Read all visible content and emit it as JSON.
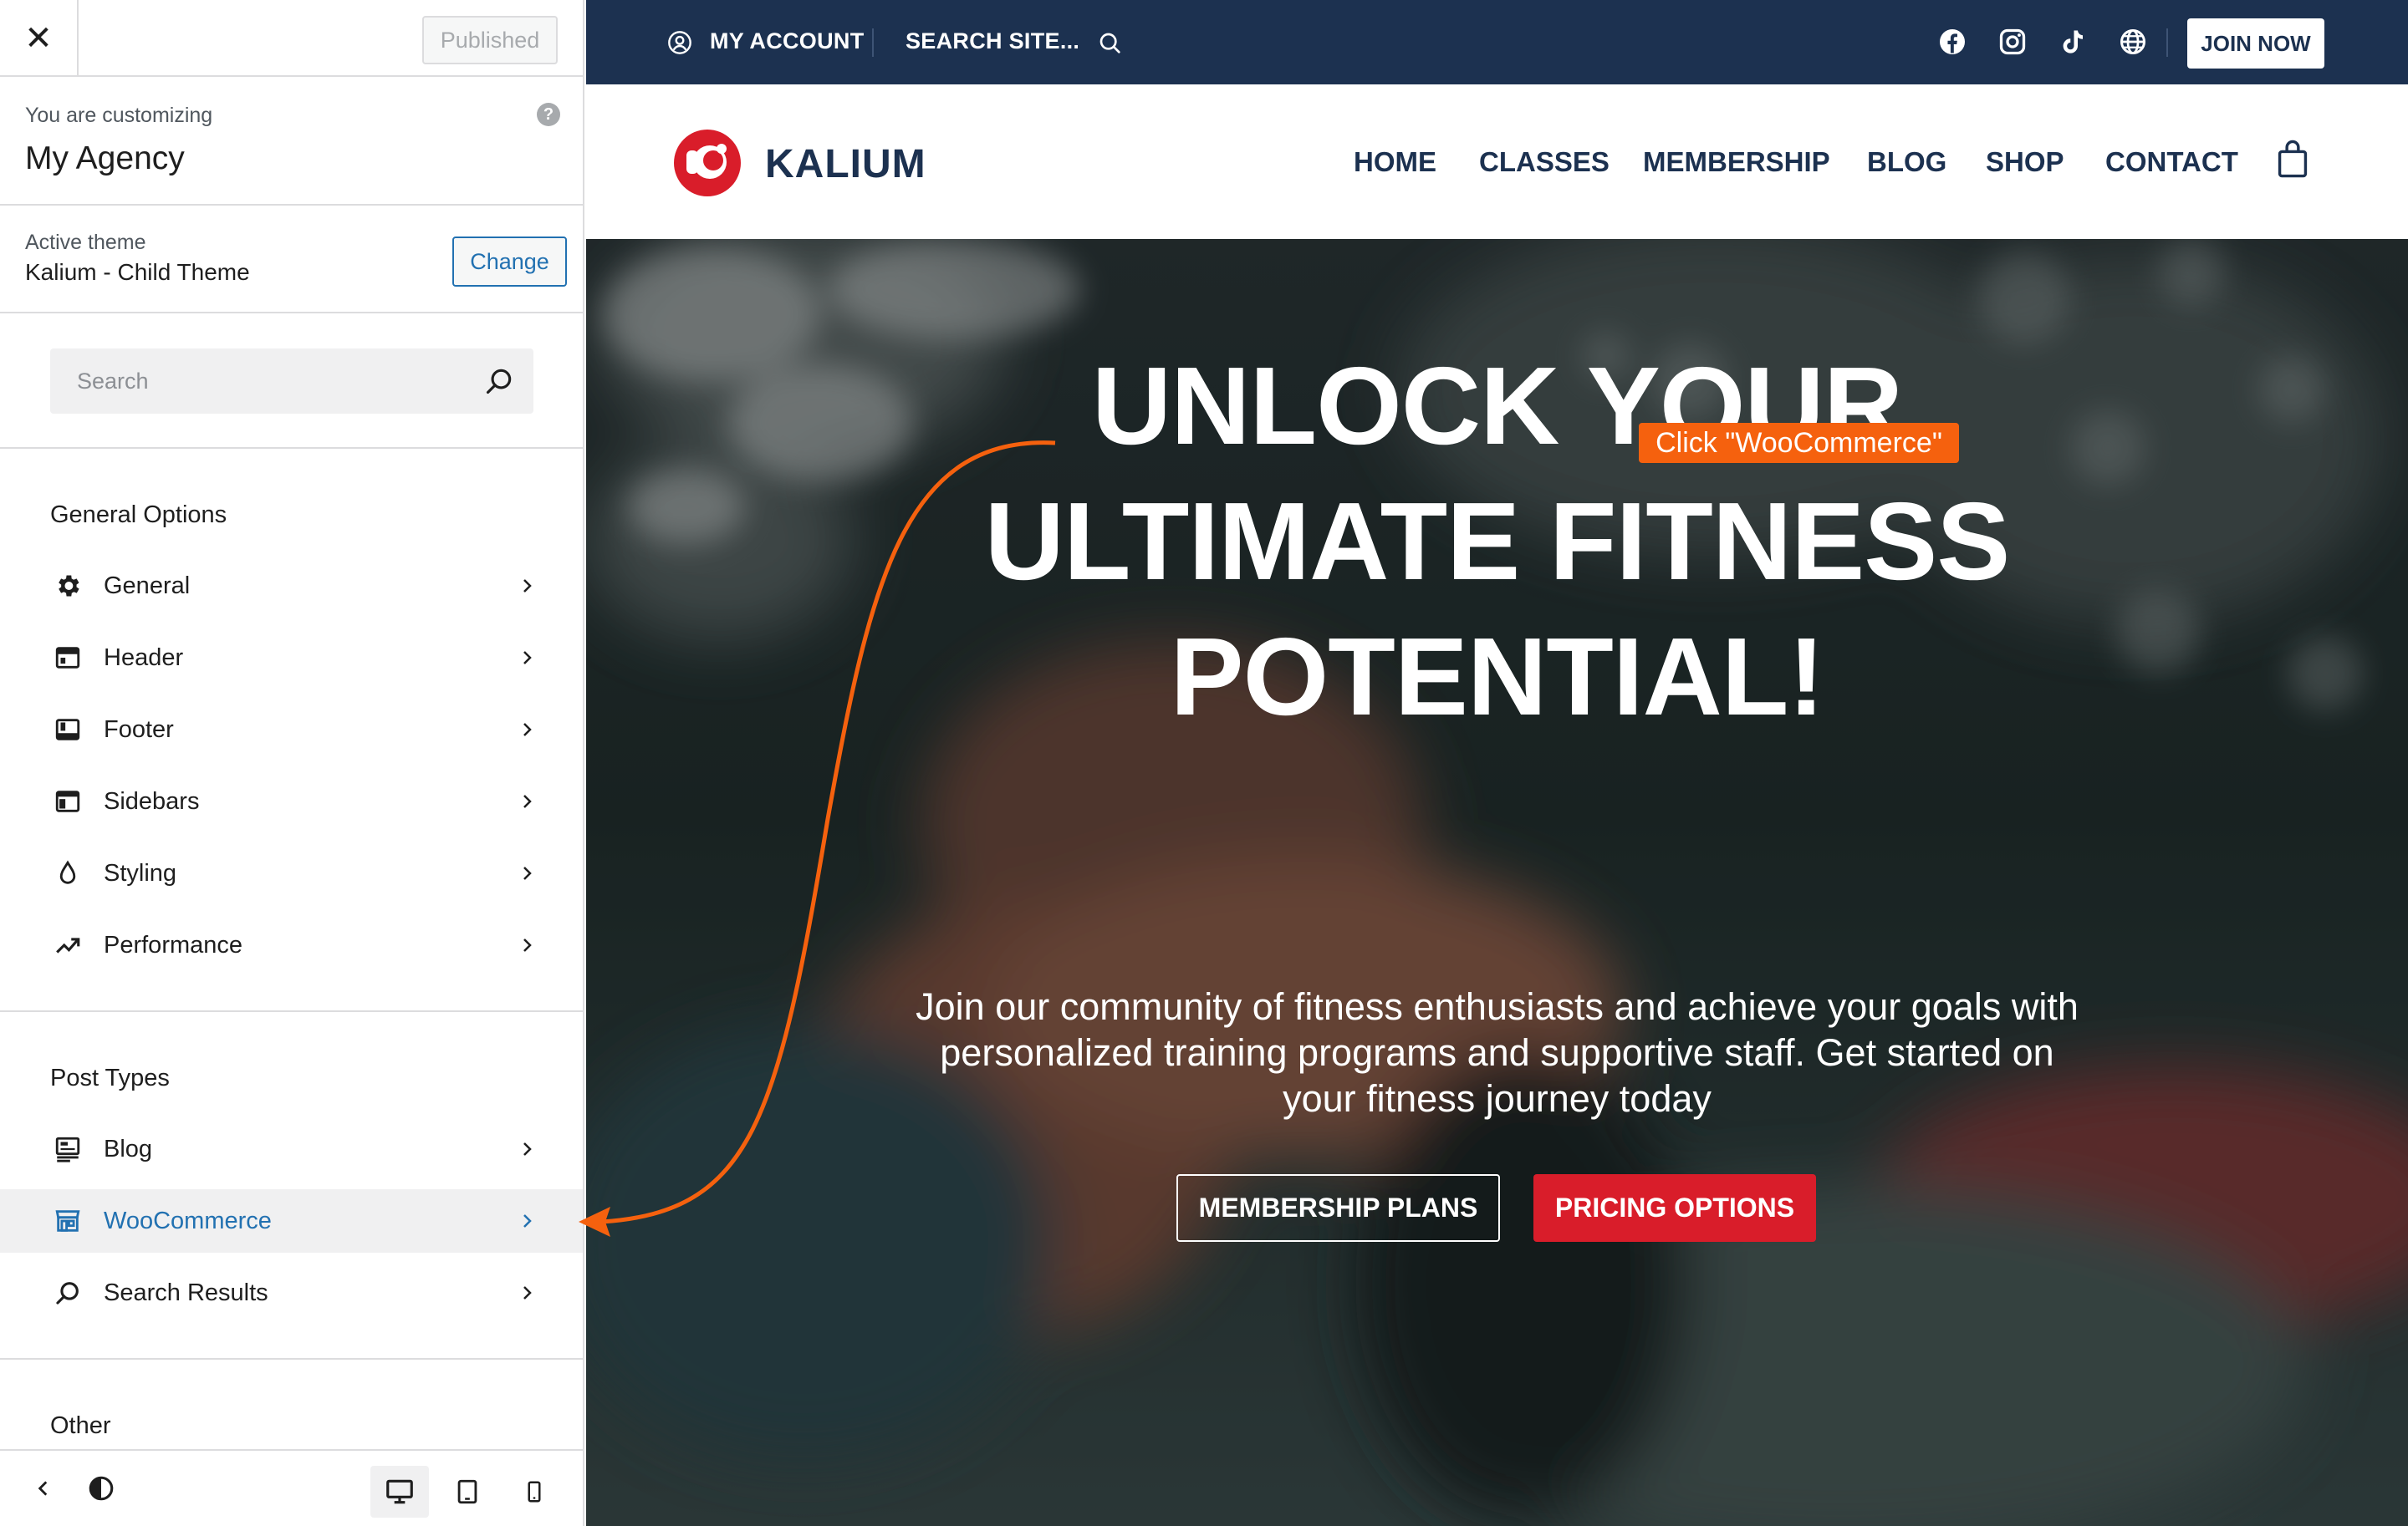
{
  "colors": {
    "navy": "#1c3150",
    "accent_blue": "#2271b1",
    "red": "#d91d2a",
    "annotation_orange": "#f5610e"
  },
  "sidebar": {
    "close_icon": "close-icon",
    "published_label": "Published",
    "customizing_pre": "You are customizing",
    "site_title": "My Agency",
    "help_glyph": "?",
    "theme_pre": "Active theme",
    "theme_name": "Kalium - Child Theme",
    "change_label": "Change",
    "search_placeholder": "Search",
    "sections": {
      "general_title": "General Options",
      "post_types_title": "Post Types",
      "other_title": "Other"
    },
    "general_items": [
      {
        "label": "General",
        "icon": "gear-icon"
      },
      {
        "label": "Header",
        "icon": "header-layout-icon"
      },
      {
        "label": "Footer",
        "icon": "footer-layout-icon"
      },
      {
        "label": "Sidebars",
        "icon": "sidebar-layout-icon"
      },
      {
        "label": "Styling",
        "icon": "droplet-icon"
      },
      {
        "label": "Performance",
        "icon": "trend-up-icon"
      }
    ],
    "post_type_items": [
      {
        "label": "Blog",
        "icon": "blog-icon"
      },
      {
        "label": "WooCommerce",
        "icon": "store-icon",
        "active": true
      },
      {
        "label": "Search Results",
        "icon": "search-icon"
      }
    ],
    "footer": {
      "collapse_icon": "chevron-left-icon",
      "contrast_icon": "contrast-icon",
      "devices": [
        "desktop-icon",
        "tablet-icon",
        "mobile-icon"
      ],
      "active_device": "desktop-icon"
    }
  },
  "preview": {
    "topbar": {
      "account_label": "MY ACCOUNT",
      "search_label": "SEARCH SITE...",
      "social_icons": [
        "facebook-icon",
        "instagram-icon",
        "tiktok-icon",
        "globe-icon"
      ],
      "join_label": "JOIN NOW"
    },
    "brand": "KALIUM",
    "nav": [
      "HOME",
      "CLASSES",
      "MEMBERSHIP",
      "BLOG",
      "SHOP",
      "CONTACT"
    ],
    "cart_icon": "shopping-bag-icon",
    "hero": {
      "title_lines": [
        "UNLOCK YOUR",
        "ULTIMATE FITNESS",
        "POTENTIAL!"
      ],
      "subtitle_lines": [
        "Join our community of fitness enthusiasts and achieve your goals with",
        "personalized training programs and supportive staff. Get started on",
        "your fitness journey today"
      ],
      "primary_cta": "MEMBERSHIP PLANS",
      "secondary_cta": "PRICING OPTIONS"
    }
  },
  "annotation": {
    "label": "Click \"WooCommerce\""
  }
}
